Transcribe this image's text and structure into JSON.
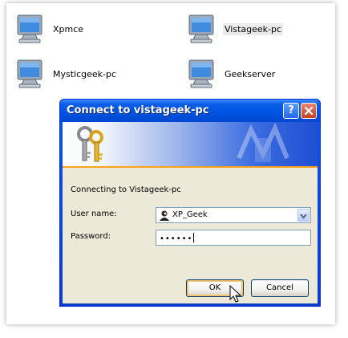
{
  "network": {
    "computers": [
      {
        "name": "Xpmce",
        "selected": false
      },
      {
        "name": "Vistageek-pc",
        "selected": true
      },
      {
        "name": "Mysticgeek-pc",
        "selected": false
      },
      {
        "name": "Geekserver",
        "selected": false
      }
    ]
  },
  "dialog": {
    "title": "Connect to vistageek-pc",
    "help_icon": "?",
    "close_icon": "x",
    "connecting_text": "Connecting to Vistageek-pc",
    "username_label": "User name:",
    "username_value": "XP_Geek",
    "password_label": "Password:",
    "password_value": "••••••",
    "ok_label": "OK",
    "cancel_label": "Cancel"
  },
  "colors": {
    "titlebar": "#0054e3",
    "client_bg": "#ece9d8",
    "banner_accent": "#f7a41c"
  }
}
